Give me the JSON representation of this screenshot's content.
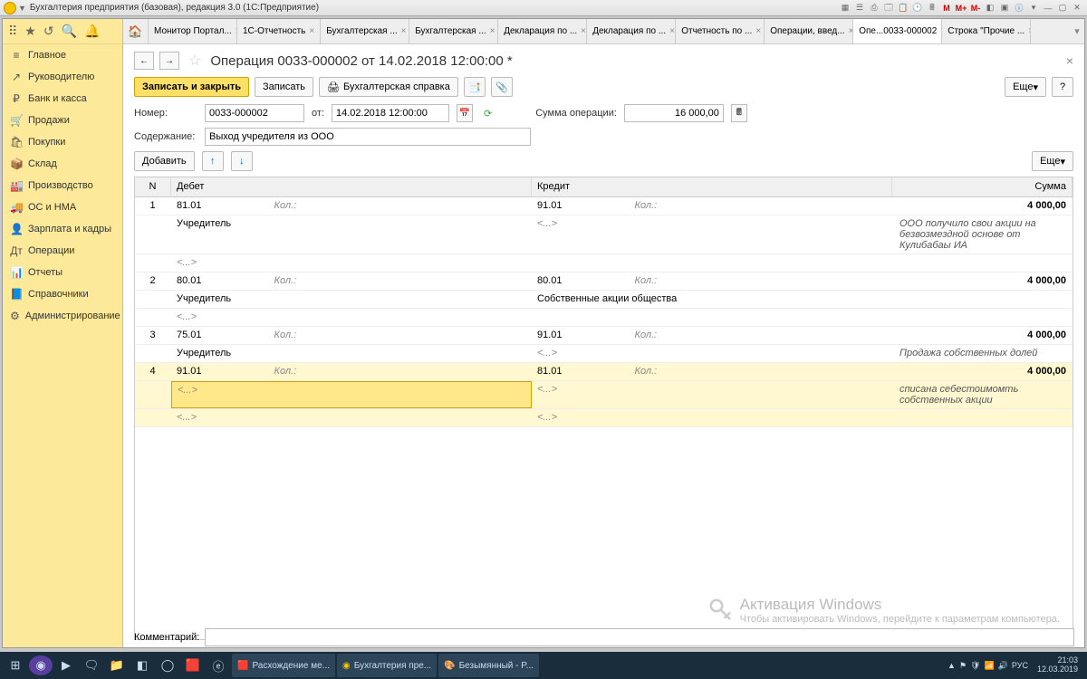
{
  "window": {
    "title": "Бухгалтерия предприятия (базовая), редакция 3.0  (1С:Предприятие)"
  },
  "titlebar_icons": [
    "M",
    "M+",
    "M-"
  ],
  "nav": {
    "items": [
      {
        "icon": "≡",
        "label": "Главное"
      },
      {
        "icon": "↗",
        "label": "Руководителю"
      },
      {
        "icon": "₽",
        "label": "Банк и касса"
      },
      {
        "icon": "🛒",
        "label": "Продажи"
      },
      {
        "icon": "🛍",
        "label": "Покупки"
      },
      {
        "icon": "📦",
        "label": "Склад"
      },
      {
        "icon": "🏭",
        "label": "Производство"
      },
      {
        "icon": "🚚",
        "label": "ОС и НМА"
      },
      {
        "icon": "👤",
        "label": "Зарплата и кадры"
      },
      {
        "icon": "Дт",
        "label": "Операции"
      },
      {
        "icon": "📊",
        "label": "Отчеты"
      },
      {
        "icon": "📘",
        "label": "Справочники"
      },
      {
        "icon": "⚙",
        "label": "Администрирование"
      }
    ]
  },
  "tabs": [
    {
      "label": "Монитор Портал...",
      "active": false
    },
    {
      "label": "1С-Отчетность",
      "active": false
    },
    {
      "label": "Бухгалтерская ...",
      "active": false
    },
    {
      "label": "Бухгалтерская ...",
      "active": false
    },
    {
      "label": "Декларация по ...",
      "active": false
    },
    {
      "label": "Декларация по ...",
      "active": false
    },
    {
      "label": "Отчетность по ...",
      "active": false
    },
    {
      "label": "Операции, введ...",
      "active": false
    },
    {
      "label": "Опе...0033-000002",
      "active": true
    },
    {
      "label": "Строка \"Прочие ...",
      "active": false
    }
  ],
  "doc": {
    "title": "Операция 0033-000002 от 14.02.2018 12:00:00 *",
    "btn_primary": "Записать и закрыть",
    "btn_save": "Записать",
    "btn_print": "Бухгалтерская справка",
    "more": "Еще",
    "help": "?",
    "lbl_number": "Номер:",
    "number": "0033-000002",
    "lbl_from": "от:",
    "date": "14.02.2018 12:00:00",
    "lbl_sum": "Сумма операции:",
    "sum": "16 000,00",
    "lbl_content": "Содержание:",
    "content": "Выход учредителя из ООО",
    "btn_add": "Добавить",
    "lbl_comment": "Комментарий:",
    "comment": ""
  },
  "grid": {
    "headers": {
      "n": "N",
      "debit": "Дебет",
      "credit": "Кредит",
      "sum": "Сумма"
    },
    "kol": "Кол.:",
    "empty": "<...>",
    "rows": [
      {
        "n": "1",
        "d_acc": "81.01",
        "d_sub1": "Учредитель",
        "d_sub2": "<...>",
        "k_acc": "91.01",
        "k_sub1": "<...>",
        "k_sub2": "",
        "sum": "4 000,00",
        "note": "ООО получило свои акции на безвозмездной основе от Кулибабаы ИА"
      },
      {
        "n": "2",
        "d_acc": "80.01",
        "d_sub1": "Учредитель",
        "d_sub2": "<...>",
        "k_acc": "80.01",
        "k_sub1": "Собственные акции общества",
        "k_sub2": "",
        "sum": "4 000,00",
        "note": ""
      },
      {
        "n": "3",
        "d_acc": "75.01",
        "d_sub1": "Учредитель",
        "d_sub2": "",
        "k_acc": "91.01",
        "k_sub1": "<...>",
        "k_sub2": "",
        "sum": "4 000,00",
        "note": "Продажа собственных долей"
      },
      {
        "n": "4",
        "d_acc": "91.01",
        "d_sub1": "<...>",
        "d_sub2": "<...>",
        "k_acc": "81.01",
        "k_sub1": "<...>",
        "k_sub2": "<...>",
        "sum": "4 000,00",
        "note": "списана себестоимомть собственных акции",
        "hl": true
      }
    ]
  },
  "watermark": {
    "title": "Активация Windows",
    "sub": "Чтобы активировать Windows, перейдите к параметрам компьютера."
  },
  "taskbar": {
    "tasks": [
      {
        "label": "Расхождение ме..."
      },
      {
        "label": "Бухгалтерия пре..."
      },
      {
        "label": "Безымянный - P..."
      }
    ],
    "lang": "РУС",
    "time": "21:03",
    "date": "12.03.2019"
  }
}
